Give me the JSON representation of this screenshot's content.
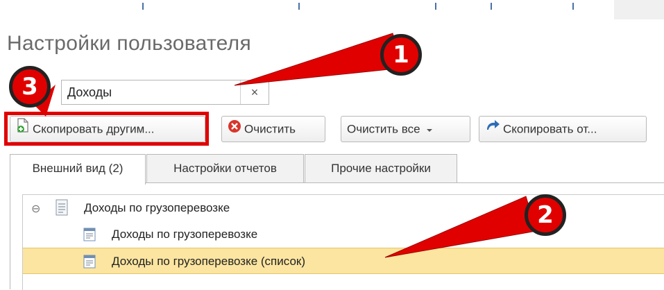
{
  "page": {
    "title": "Настройки пользователя"
  },
  "search": {
    "value": "Доходы",
    "clear_label": "×"
  },
  "toolbar": {
    "copy_to_others_label": "Скопировать другим...",
    "clear_label": "Очистить",
    "clear_all_label": "Очистить все",
    "copy_from_label": "Скопировать от..."
  },
  "tabs": [
    {
      "label": "Внешний вид (2)",
      "active": true
    },
    {
      "label": "Настройки отчетов",
      "active": false
    },
    {
      "label": "Прочие настройки",
      "active": false
    }
  ],
  "tree": {
    "group": {
      "label": "Доходы по грузоперевозке",
      "expanded": true,
      "toggle": "⊖"
    },
    "items": [
      {
        "label": "Доходы по грузоперевозке",
        "selected": false
      },
      {
        "label": "Доходы по грузоперевозке (список)",
        "selected": true
      }
    ]
  },
  "annotations": {
    "marker_1": "1",
    "marker_2": "2",
    "marker_3": "3",
    "color": "#e00000"
  },
  "colors": {
    "selection": "#fbe5a0",
    "clear_icon": "#d9352b",
    "copy_icon": "#2d6db5"
  }
}
